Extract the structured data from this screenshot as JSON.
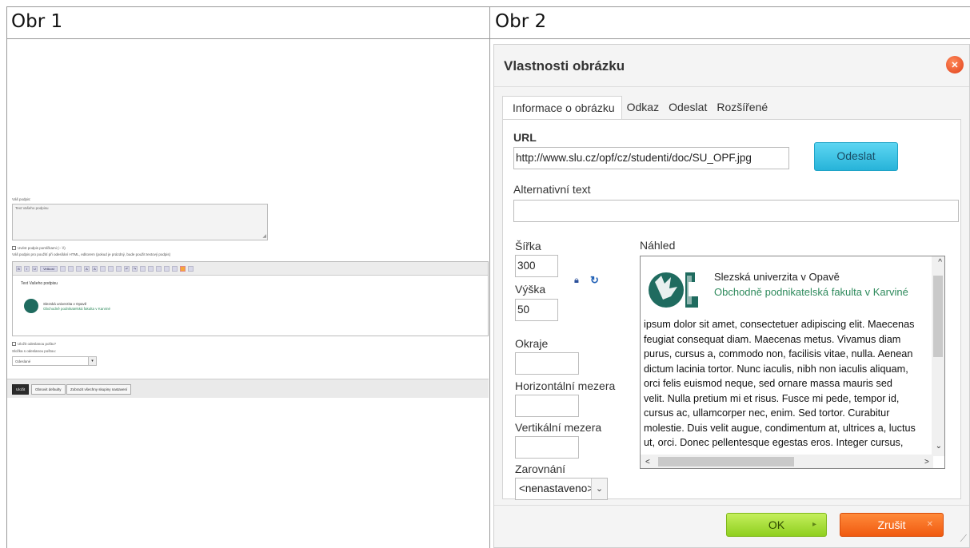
{
  "table": {
    "headers": [
      "Obr 1",
      "Obr 2"
    ]
  },
  "obr1": {
    "signature_label": "Váš podpis:",
    "signature_value": "Text Vašeho podpisu",
    "separate_checkbox": "Uvést podpis pomlčkami (-- \\\\)",
    "html_hint": "Váš podpis pro použití při odesílání HTML, editorem (pokud je prázdný, bude použit textový podpis)",
    "editor_heading": "Text Vašeho podpisu",
    "editor_uni": "Slezská univerzita v Opavě",
    "editor_fac": "Obchodně podnikatelská fakulta v Karviné",
    "save_sent_checkbox": "Uložit odeslanou poštu?",
    "folder_label": "Složka s odeslanou poštou:",
    "folder_value": "Odeslané",
    "btn_save": "Uložit",
    "btn_reset": "Obnovit defaulty",
    "btn_group": "Zobrazit všechny skupiny nastavení",
    "toolbar_font_box": "Velikost"
  },
  "dialog": {
    "title": "Vlastnosti obrázku",
    "tabs": [
      "Informace o obrázku",
      "Odkaz",
      "Odeslat",
      "Rozšířené"
    ],
    "url_label": "URL",
    "url_value": "http://www.slu.cz/opf/cz/studenti/doc/SU_OPF.jpg",
    "send_button": "Odeslat",
    "alt_label": "Alternativní text",
    "alt_value": "",
    "width_label": "Šířka",
    "width_value": "300",
    "height_label": "Výška",
    "height_value": "50",
    "border_label": "Okraje",
    "hspace_label": "Horizontální mezera",
    "vspace_label": "Vertikální mezera",
    "align_label": "Zarovnání",
    "align_value": "<nenastaveno>",
    "preview_label": "Náhled",
    "preview_uni": "Slezská univerzita v Opavě",
    "preview_fac": "Obchodně podnikatelská fakulta v Karviné",
    "preview_lines": [
      "ipsum dolor sit amet, consectetuer adipiscing elit. Maecenas",
      "feugiat consequat diam. Maecenas metus. Vivamus diam",
      "purus, cursus a, commodo non, facilisis vitae, nulla. Aenean",
      "dictum lacinia tortor. Nunc iaculis, nibh non iaculis aliquam,",
      "orci felis euismod neque, sed ornare massa mauris sed",
      "velit. Nulla pretium mi et risus. Fusce mi pede, tempor id,",
      "cursus ac, ullamcorper nec, enim. Sed tortor. Curabitur",
      "molestie. Duis velit augue, condimentum at, ultrices a, luctus",
      "ut, orci. Donec pellentesque egestas eros. Integer cursus,"
    ],
    "ok_button": "OK",
    "cancel_button": "Zrušit"
  },
  "colors": {
    "send": "#27b3d9",
    "ok": "#8fcf1f",
    "cancel": "#f05a10",
    "close": "#e0401a",
    "faculty_green": "#2e8a5c"
  }
}
